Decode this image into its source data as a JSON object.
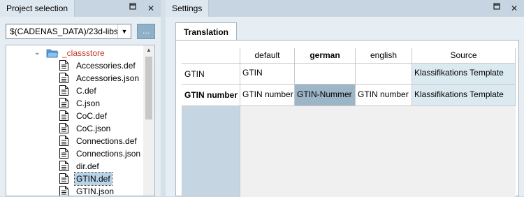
{
  "left_panel": {
    "title": "Project selection",
    "pin_icon": "pin-icon",
    "close_glyph": "✕",
    "path_value": "$(CADENAS_DATA)/23d-libs",
    "browse_label": "...",
    "folder": "_classstore",
    "files": [
      "Accessories.def",
      "Accessories.json",
      "C.def",
      "C.json",
      "CoC.def",
      "CoC.json",
      "Connections.def",
      "Connections.json",
      "dir.def",
      "GTIN.def",
      "GTIN.json"
    ],
    "selected_file": "GTIN.def"
  },
  "right_panel": {
    "title": "Settings",
    "pin_icon": "pin-icon",
    "close_glyph": "✕",
    "tab_label": "Translation",
    "table": {
      "columns": [
        "default",
        "german",
        "english",
        "Source"
      ],
      "bold_column": "german",
      "rows": [
        {
          "label": "GTIN",
          "default": "GTIN",
          "german": "",
          "english": "",
          "source": "Klassifikations Template"
        },
        {
          "label": "GTIN number",
          "default": "GTIN number",
          "german": "GTIN-Nummer",
          "english": "GTIN number",
          "source": "Klassifikations Template"
        }
      ],
      "selected_row": "GTIN number",
      "highlighted_cell": "GTIN-Nummer"
    }
  },
  "colors": {
    "header": "#c6d5e1",
    "selection": "#b7d3e8",
    "source_cell": "#dbe9f1",
    "highlight_cell": "#9cb6c8",
    "folder_name": "#c0392b"
  }
}
